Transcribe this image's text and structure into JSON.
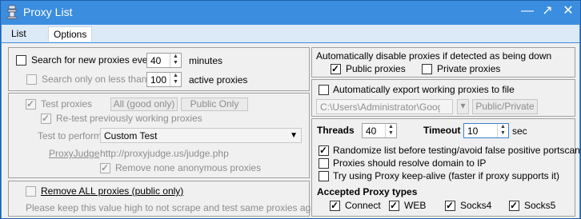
{
  "window": {
    "title": "Proxy List",
    "controls": {
      "minimize": "—",
      "maximize": "↗",
      "close": "✕"
    }
  },
  "menu": {
    "list": "List",
    "options": "Options"
  },
  "left": {
    "search_new": {
      "label": "Search for new proxies every",
      "value": "40",
      "suffix": "minutes",
      "checked": false
    },
    "search_only": {
      "label": "Search only on less than",
      "value": "100",
      "suffix": "active proxies",
      "checked": false
    },
    "test_proxies": {
      "label": "Test proxies",
      "checked": true
    },
    "all_good_button": "All (good only)",
    "public_only_button": "Public Only",
    "retest": {
      "label": "Re-test previously working proxies",
      "checked": true
    },
    "test_to_perform": {
      "label": "Test to perform",
      "value": "Custom Test"
    },
    "proxy_judge": {
      "label": "ProxyJudge",
      "value": "http://proxyjudge.us/judge.php"
    },
    "remove_anon": {
      "label": "Remove none anonymous proxies",
      "checked": true
    },
    "remove_all": {
      "label": "Remove ALL proxies (public only)",
      "checked": false
    },
    "note": "Please keep this value high to not scrape and test same proxies again."
  },
  "right": {
    "auto_disable_label": "Automatically disable proxies if detected as being down",
    "public_proxies": {
      "label": "Public proxies",
      "checked": true
    },
    "private_proxies": {
      "label": "Private proxies",
      "checked": false
    },
    "auto_export": {
      "label": "Automatically export working proxies to file",
      "checked": false
    },
    "export_path": "C:\\Users\\Administrator\\Google",
    "public_private_button": "Public/Private",
    "threads": {
      "label": "Threads",
      "value": "40"
    },
    "timeout": {
      "label": "Timeout",
      "value": "10",
      "suffix": "sec"
    },
    "randomize": {
      "label": "Randomize list before testing/avoid false positive portscans",
      "checked": true
    },
    "resolve_domain": {
      "label": "Proxies should resolve domain to IP",
      "checked": false
    },
    "keep_alive": {
      "label": "Try using Proxy keep-alive (faster if proxy supports it)",
      "checked": false
    },
    "accepted_types_label": "Accepted Proxy types",
    "types": [
      {
        "label": "Connect",
        "checked": true
      },
      {
        "label": "WEB",
        "checked": true
      },
      {
        "label": "Socks4",
        "checked": true
      },
      {
        "label": "Socks5",
        "checked": true
      }
    ]
  }
}
